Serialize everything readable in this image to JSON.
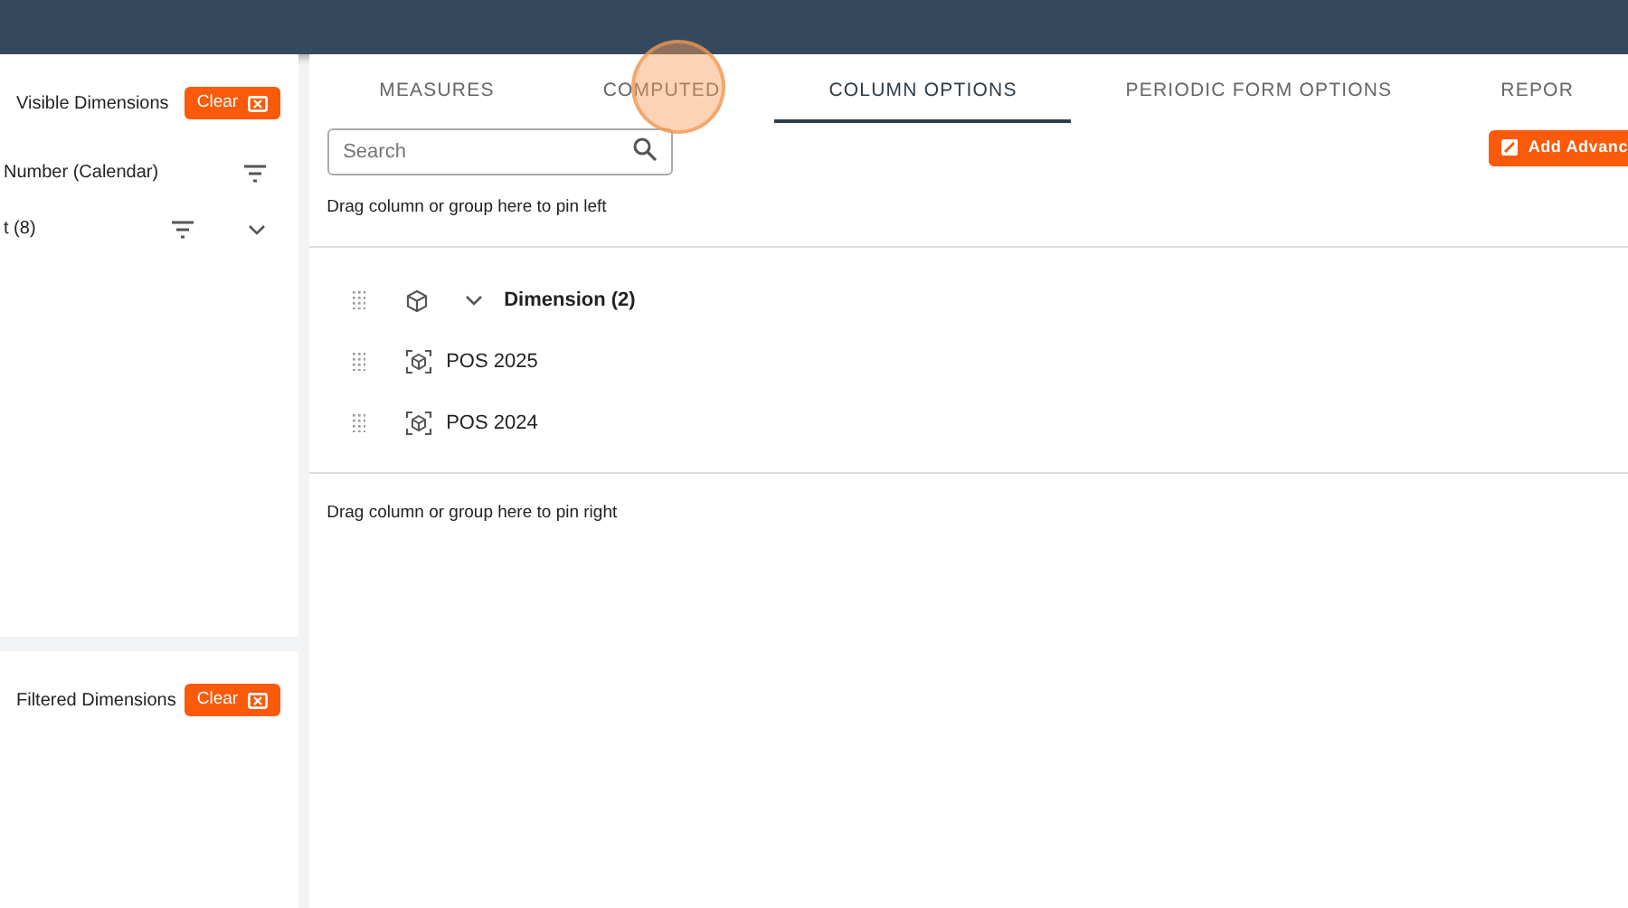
{
  "left_panels": [
    {
      "title": "Visible Dimensions",
      "clear_label": "Clear",
      "rows": [
        {
          "label": "Number (Calendar)",
          "filter": true,
          "expandable": false
        },
        {
          "label": "t (8)",
          "filter": true,
          "expandable": true
        }
      ]
    },
    {
      "title": "Filtered Dimensions",
      "clear_label": "Clear"
    }
  ],
  "tabs": [
    {
      "label": "MEASURES",
      "selected": false
    },
    {
      "label": "COMPUTED",
      "selected": false,
      "click_highlight": true
    },
    {
      "label": "COLUMN OPTIONS",
      "selected": true
    },
    {
      "label": "PERIODIC FORM OPTIONS",
      "selected": false
    },
    {
      "label": "REPOR",
      "selected": false
    }
  ],
  "search": {
    "placeholder": "Search"
  },
  "add_button": "Add Advanc",
  "pin_left": "Drag column or group here to pin left",
  "columns": [
    {
      "kind": "group",
      "label": "Dimension (2)",
      "expanded": true
    },
    {
      "kind": "item",
      "label": "POS 2025"
    },
    {
      "kind": "item",
      "label": "POS 2024"
    }
  ],
  "pin_right": "Drag column or group here to pin right"
}
